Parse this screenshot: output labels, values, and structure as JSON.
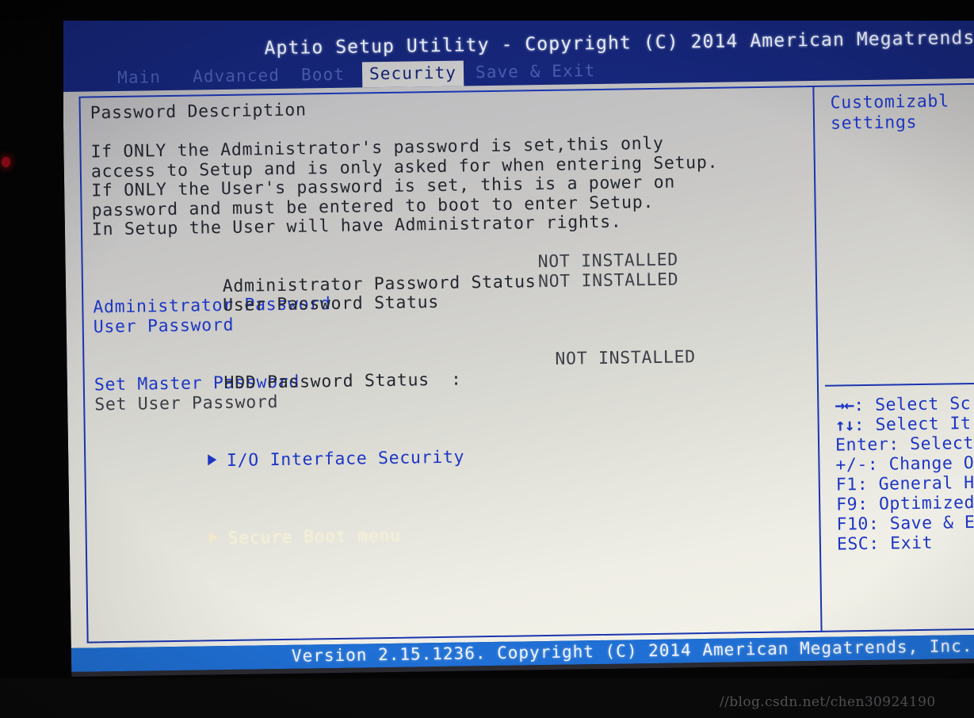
{
  "window": {
    "title": "Aptio Setup Utility - Copyright (C) 2014 American Megatrends",
    "footer": "Version 2.15.1236. Copyright (C) 2014 American Megatrends, Inc.",
    "watermark": "//blog.csdn.net/chen30924190"
  },
  "menubar": {
    "tabs": [
      {
        "label": "Main",
        "active": false
      },
      {
        "label": "Advanced",
        "active": false
      },
      {
        "label": "Boot",
        "active": false
      },
      {
        "label": "Security",
        "active": true
      },
      {
        "label": "Save & Exit",
        "active": false
      }
    ]
  },
  "main": {
    "section_title": "Password Description",
    "description": [
      "If ONLY the Administrator's password is set,this only",
      "access to Setup and is only asked for when entering Setup.",
      "If ONLY the User's password is set, this is a power on",
      "password and must be entered to boot to enter Setup.",
      "In Setup the User will have Administrator rights."
    ],
    "status_rows": [
      {
        "label": "Administrator Password Status",
        "value": "NOT INSTALLED"
      },
      {
        "label": "User Password Status",
        "value": "NOT INSTALLED"
      }
    ],
    "password_items": [
      {
        "label": "Administrator Password"
      },
      {
        "label": "User Password"
      }
    ],
    "hdd_row": {
      "label": "HDD Password Status  :",
      "value": "NOT INSTALLED"
    },
    "hdd_items": [
      {
        "label": "Set Master Password",
        "enabled": true
      },
      {
        "label": "Set User Password",
        "enabled": false
      }
    ],
    "submenus": [
      {
        "label": "I/O Interface Security",
        "selected": false
      },
      {
        "label": "Secure Boot menu",
        "selected": true
      }
    ]
  },
  "help": {
    "lines": [
      "Customizabl",
      "settings"
    ],
    "keys": [
      {
        "glyph": "→←",
        "text": ": Select Sc"
      },
      {
        "glyph": "↑↓",
        "text": ": Select It"
      },
      {
        "glyph": "",
        "text": "Enter: Select"
      },
      {
        "glyph": "",
        "text": "+/-: Change O"
      },
      {
        "glyph": "",
        "text": "F1: General H"
      },
      {
        "glyph": "",
        "text": "F9: Optimized"
      },
      {
        "glyph": "",
        "text": "F10: Save & E"
      },
      {
        "glyph": "",
        "text": "ESC: Exit"
      }
    ]
  },
  "colors": {
    "header_blue": "#16267a",
    "footer_blue": "#1f6fd4",
    "frame_blue": "#1b35b0",
    "link_blue": "#1d36c4",
    "selected_cream": "#f4efd8",
    "panel_bg": "#dddad2"
  }
}
